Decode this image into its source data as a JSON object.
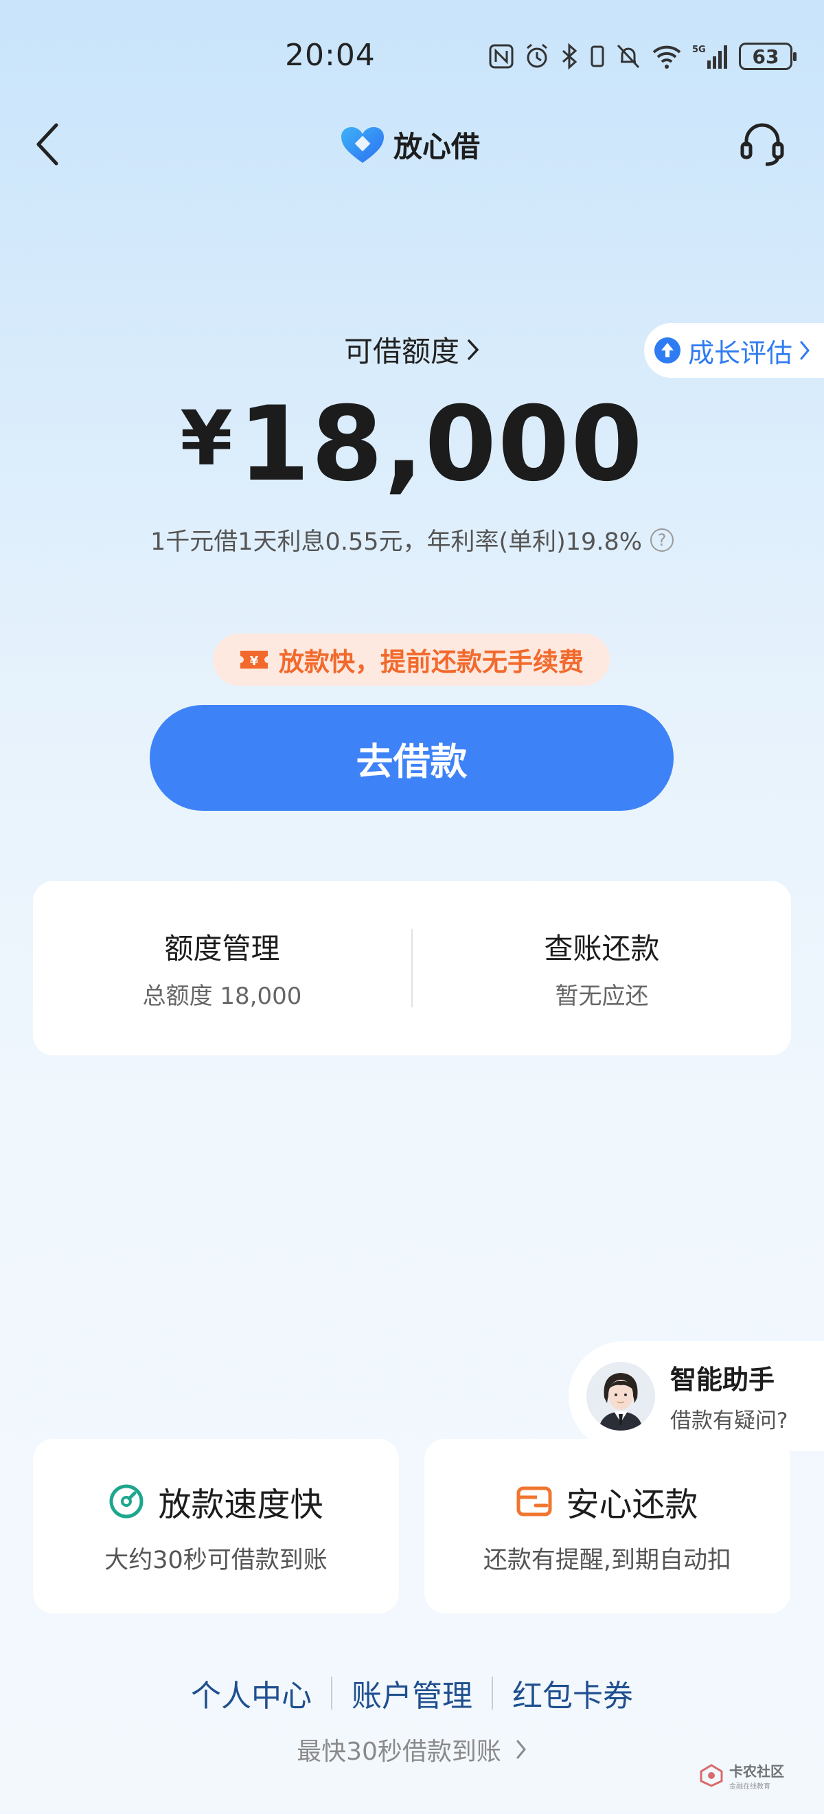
{
  "status_bar": {
    "time": "20:04",
    "battery": "63"
  },
  "nav": {
    "brand_name": "放心借"
  },
  "credit": {
    "label": "可借额度",
    "growth_label": "成长评估",
    "amount": "18,000",
    "currency": "¥",
    "rate_text": "1千元借1天利息0.55元，年利率(单利)19.8%"
  },
  "promo": {
    "text": "放款快，提前还款无手续费"
  },
  "borrow_button": {
    "label": "去借款"
  },
  "cards": {
    "quota": {
      "title": "额度管理",
      "sub": "总额度 18,000"
    },
    "repay": {
      "title": "查账还款",
      "sub": "暂无应还"
    }
  },
  "assistant": {
    "title": "智能助手",
    "sub": "借款有疑问?"
  },
  "features": [
    {
      "title": "放款速度快",
      "sub": "大约30秒可借款到账",
      "icon": "speed-gauge-icon",
      "color": "#1ca78d"
    },
    {
      "title": "安心还款",
      "sub": "还款有提醒,到期自动扣",
      "icon": "wallet-icon",
      "color": "#f0762f"
    }
  ],
  "links": [
    "个人中心",
    "账户管理",
    "红包卡券"
  ],
  "tagline": "最快30秒借款到账",
  "watermark": {
    "title": "卡农社区",
    "sub": "金融在线教育"
  },
  "colors": {
    "accent": "#3e82f7",
    "promo_text": "#f2692c",
    "link": "#1f4f8f"
  }
}
